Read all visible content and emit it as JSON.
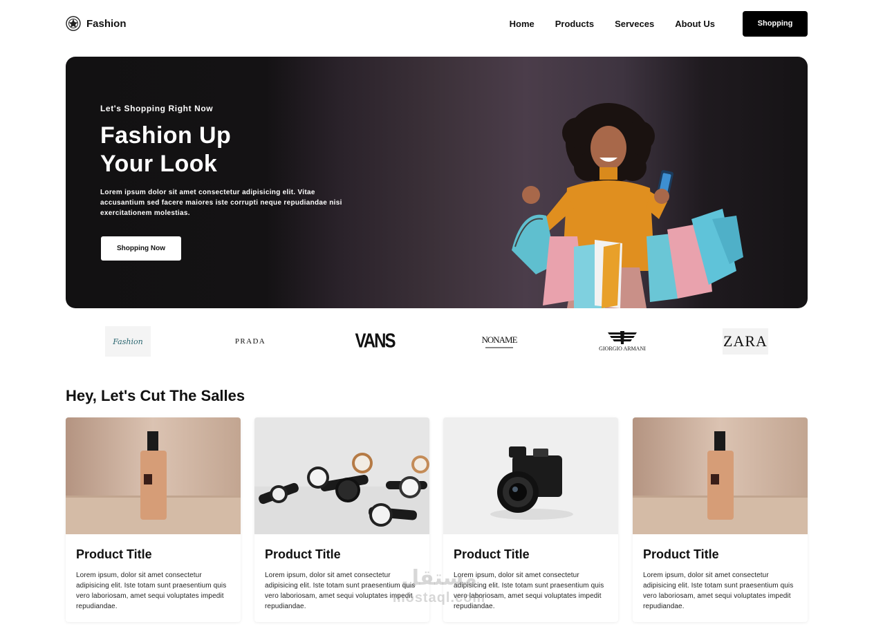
{
  "nav": {
    "brand": "Fashion",
    "links": [
      "Home",
      "Products",
      "Serveces",
      "About Us"
    ],
    "cta": "Shopping"
  },
  "hero": {
    "eyebrow": "Let's Shopping Right Now",
    "title_line1": "Fashion Up",
    "title_line2": "Your Look",
    "text": "Lorem ipsum dolor sit amet consectetur adipisicing elit. Vitae accusantium sed facere maiores iste corrupti neque repudiandae nisi exercitationem molestias.",
    "button": "Shopping Now"
  },
  "brands": [
    "Fashion",
    "PRADA",
    "VANS",
    "NONAME",
    "GIORGIO ARMANI",
    "ZARA"
  ],
  "section": {
    "title": "Hey, Let's Cut The Salles"
  },
  "products": [
    {
      "image": "perfume-bottle",
      "title": "Product Title",
      "text": "Lorem ipsum, dolor sit amet consectetur adipisicing elit. Iste totam sunt praesentium quis vero laboriosam, amet sequi voluptates impedit repudiandae."
    },
    {
      "image": "watches",
      "title": "Product Title",
      "text": "Lorem ipsum, dolor sit amet consectetur adipisicing elit. Iste totam sunt praesentium quis vero laboriosam, amet sequi voluptates impedit repudiandae."
    },
    {
      "image": "camera",
      "title": "Product Title",
      "text": "Lorem ipsum, dolor sit amet consectetur adipisicing elit. Iste totam sunt praesentium quis vero laboriosam, amet sequi voluptates impedit repudiandae."
    },
    {
      "image": "perfume-bottle",
      "title": "Product Title",
      "text": "Lorem ipsum, dolor sit amet consectetur adipisicing elit. Iste totam sunt praesentium quis vero laboriosam, amet sequi voluptates impedit repudiandae."
    }
  ],
  "watermark": {
    "arabic": "مستقل",
    "latin": "mostaql.com"
  },
  "colors": {
    "accent": "#000000",
    "hero_dark": "#121112",
    "hero_mid": "#4b3d4a"
  }
}
